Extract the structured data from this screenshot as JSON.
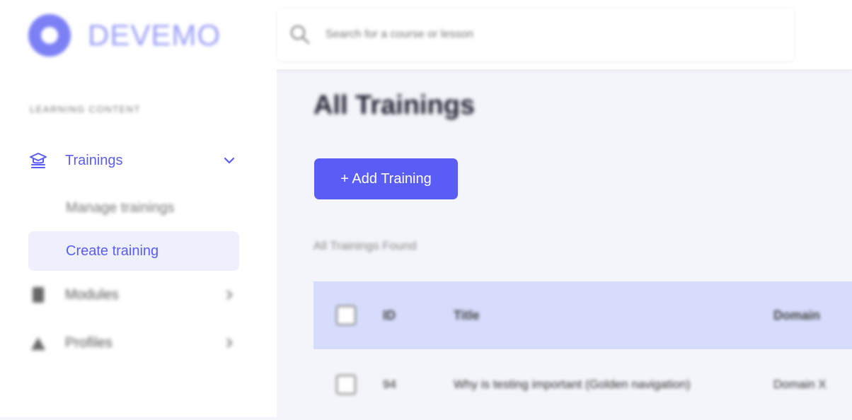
{
  "header": {
    "logo_text": "DEVEMO",
    "search_placeholder": "Search for a course or lesson"
  },
  "sidebar": {
    "section_label": "LEARNING CONTENT",
    "items": [
      {
        "label": "Trainings",
        "expanded": true,
        "icon": "graduation-cap-icon"
      },
      {
        "label": "Modules",
        "expanded": false,
        "icon": "module-icon"
      },
      {
        "label": "Profiles",
        "expanded": false,
        "icon": "profile-icon"
      }
    ],
    "sub_items": [
      {
        "label": "Manage trainings"
      },
      {
        "label": "Create training",
        "active": true
      }
    ]
  },
  "main": {
    "title": "All Trainings",
    "add_button_label": "+ Add Training",
    "found_text": "All Trainings Found",
    "table": {
      "columns": [
        "ID",
        "Title",
        "Domain"
      ],
      "rows": [
        {
          "id": "94",
          "title": "Why is testing important (Golden navigation)",
          "domain": "Domain X"
        }
      ]
    }
  },
  "colors": {
    "accent": "#5a5df5",
    "active_bg": "#eef0fd",
    "table_header_bg": "#d6dcfb",
    "page_bg": "#f4f5fa"
  }
}
